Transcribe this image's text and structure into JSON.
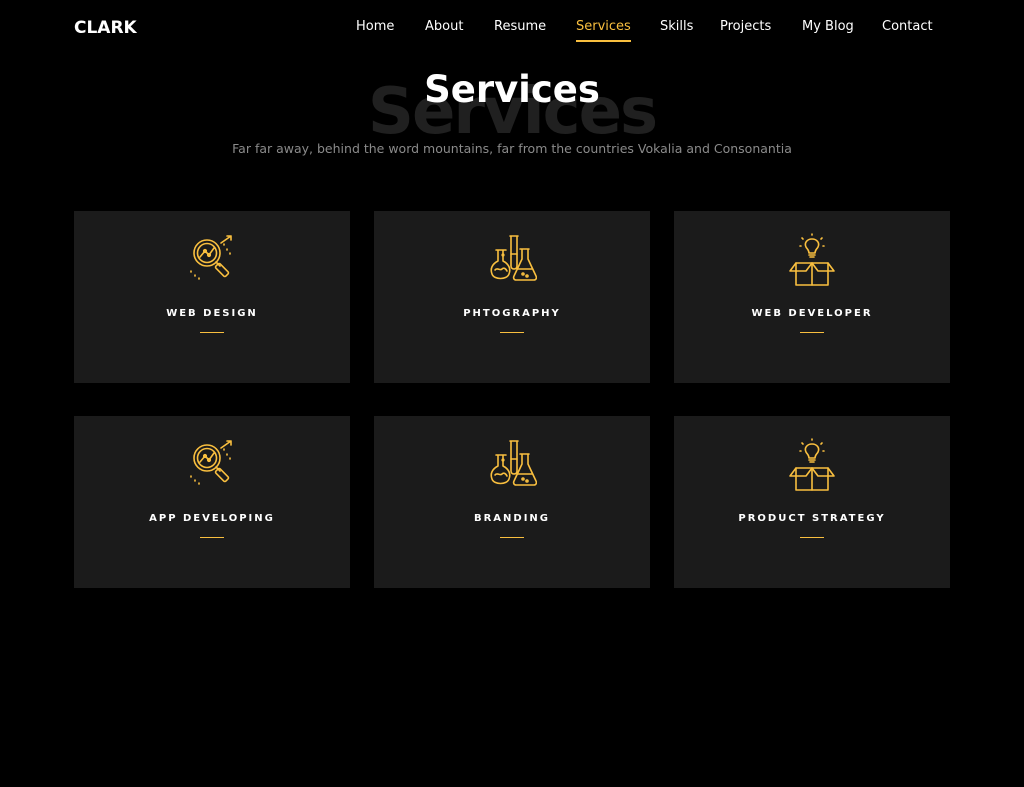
{
  "brand": {
    "name": "CLARK"
  },
  "nav": {
    "items": [
      {
        "label": "Home"
      },
      {
        "label": "About"
      },
      {
        "label": "Resume"
      },
      {
        "label": "Services"
      },
      {
        "label": "Skills"
      },
      {
        "label": "Projects"
      },
      {
        "label": "My Blog"
      },
      {
        "label": "Contact"
      }
    ],
    "active": "Services"
  },
  "section": {
    "bg_title": "Services",
    "title": "Services",
    "subtitle": "Far far away, behind the word mountains, far from the countries Vokalia and Consonantia"
  },
  "services": [
    {
      "title": "WEB DESIGN",
      "icon": "magnifier-chart-icon"
    },
    {
      "title": "PHTOGRAPHY",
      "icon": "flasks-icon"
    },
    {
      "title": "WEB DEVELOPER",
      "icon": "idea-box-icon"
    },
    {
      "title": "APP DEVELOPING",
      "icon": "magnifier-chart-icon"
    },
    {
      "title": "BRANDING",
      "icon": "flasks-icon"
    },
    {
      "title": "PRODUCT STRATEGY",
      "icon": "idea-box-icon"
    }
  ],
  "colors": {
    "background": "#000000",
    "card": "#1b1b1b",
    "accent": "#f9bf3f",
    "heading_ghost": "#202020",
    "muted_text": "#8a8a8a"
  }
}
